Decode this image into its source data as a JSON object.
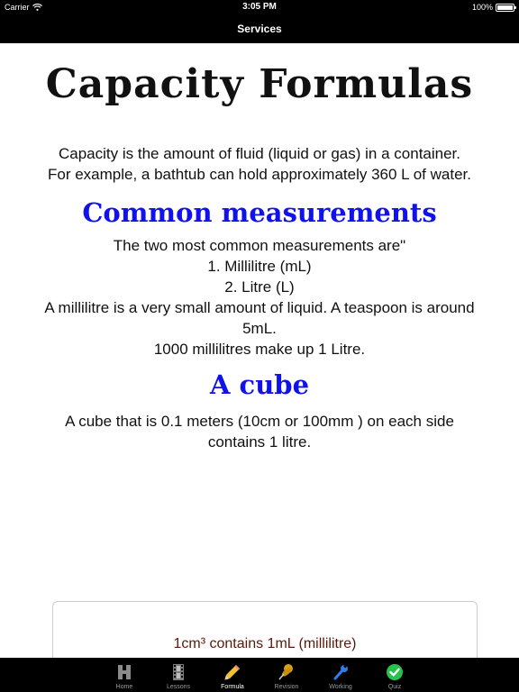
{
  "status_bar": {
    "carrier": "Carrier",
    "time": "3:05 PM",
    "battery": "100%"
  },
  "nav": {
    "title": "Services"
  },
  "content": {
    "title": "Capacity Formulas",
    "intro": [
      "Capacity is the amount of fluid (liquid or gas) in a container.",
      "For example, a bathtub can hold approximately 360 L of water."
    ],
    "section1": {
      "heading": "Common measurements",
      "lines": [
        "The two most common measurements are\"",
        "1. Millilitre (mL)",
        "2. Litre (L)",
        "A millilitre is a very small amount of liquid.  A teaspoon is around 5mL.",
        "1000 millilitres make up 1 Litre."
      ]
    },
    "section2": {
      "heading": "A cube",
      "text": "A cube that is 0.1 meters (10cm or 100mm ) on each side contains 1 litre."
    },
    "box_text": "1cm³ contains 1mL (millilitre)"
  },
  "tabs": [
    {
      "label": "Home",
      "icon": "home-icon"
    },
    {
      "label": "Lessons",
      "icon": "film-icon"
    },
    {
      "label": "Formula",
      "icon": "pencil-icon"
    },
    {
      "label": "Revision",
      "icon": "pushpin-icon"
    },
    {
      "label": "Working",
      "icon": "wrench-icon"
    },
    {
      "label": "Quiz",
      "icon": "checkmark-icon"
    }
  ],
  "active_tab": "Formula"
}
